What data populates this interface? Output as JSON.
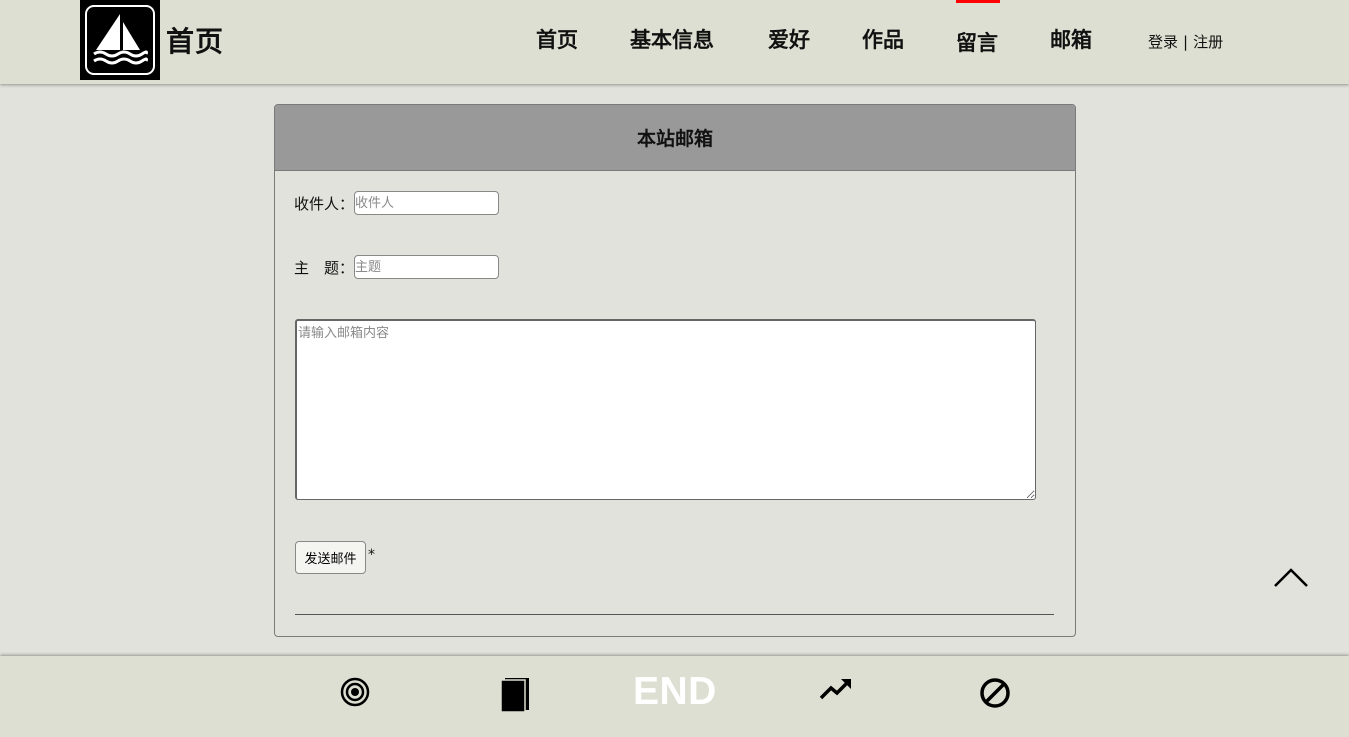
{
  "header": {
    "brand": "首页",
    "logo_icon": "sailboat-icon",
    "nav": [
      "首页",
      "基本信息",
      "爱好",
      "作品",
      "留言",
      "邮箱"
    ],
    "active_nav_marker": "留言",
    "auth": {
      "login": "登录",
      "separator": "|",
      "register": "注册"
    }
  },
  "panel": {
    "title": "本站邮箱",
    "recipient_label": "收件人：",
    "recipient_placeholder": "收件人",
    "subject_label": "主　题：",
    "subject_placeholder": "主题",
    "content_placeholder": "请输入邮箱内容",
    "send_label": "发送邮件",
    "asterisk": "*"
  },
  "footer": {
    "icons": [
      "target-icon",
      "book-icon",
      "trending-up-icon",
      "prohibited-icon"
    ],
    "end_text": "END"
  },
  "colors": {
    "page_bg": "#e1e2db",
    "header_bg": "#dcdfd1",
    "panel_head_bg": "#999999",
    "active_marker": "#ff0000",
    "end_text": "#ffffff"
  }
}
